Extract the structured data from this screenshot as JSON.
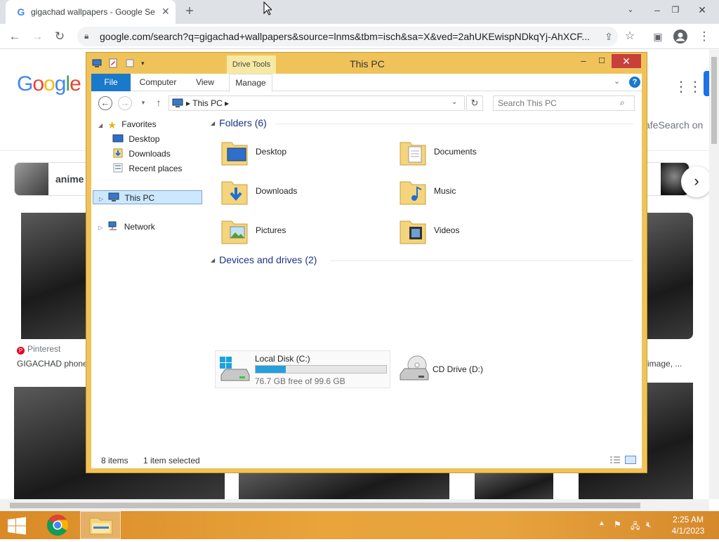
{
  "browser": {
    "tab_title": "gigachad wallpapers - Google Se",
    "new_tab": "+",
    "url": "google.com/search?q=gigachad+wallpapers&source=lnms&tbm=isch&sa=X&ved=2ahUKEwispNDkqYj-AhXCF..."
  },
  "google": {
    "logo": [
      "G",
      "o",
      "o",
      "g",
      "l",
      "e"
    ],
    "safesearch": "afeSearch on",
    "chips": {
      "anime": "anime"
    },
    "results": {
      "source_left": "Pinterest",
      "caption_left": "GIGACHAD phone",
      "caption_right": "d image, ..."
    }
  },
  "explorer": {
    "title": "This PC",
    "drive_tools": "Drive Tools",
    "ribbon_tabs": {
      "file": "File",
      "computer": "Computer",
      "view": "View",
      "manage": "Manage"
    },
    "address": "This PC",
    "search_placeholder": "Search This PC",
    "nav": {
      "favorites": "Favorites",
      "desktop": "Desktop",
      "downloads": "Downloads",
      "recent": "Recent places",
      "thispc": "This PC",
      "network": "Network"
    },
    "folders_header": "Folders (6)",
    "folders": {
      "desktop": "Desktop",
      "documents": "Documents",
      "downloads": "Downloads",
      "music": "Music",
      "pictures": "Pictures",
      "videos": "Videos"
    },
    "devices_header": "Devices and drives (2)",
    "drive_c": {
      "name": "Local Disk (C:)",
      "free": "76.7 GB free of 99.6 GB",
      "used_fraction": 0.23
    },
    "drive_d": {
      "name": "CD Drive (D:)"
    },
    "status": {
      "items": "8 items",
      "selected": "1 item selected"
    }
  },
  "taskbar": {
    "time": "2:25 AM",
    "date": "4/1/2023"
  },
  "colors": {
    "explorer_frame": "#f0c35a",
    "file_tab": "#1979ca",
    "selection": "#cce8ff",
    "drive_fill": "#26a0da",
    "close_button": "#c7403a"
  }
}
